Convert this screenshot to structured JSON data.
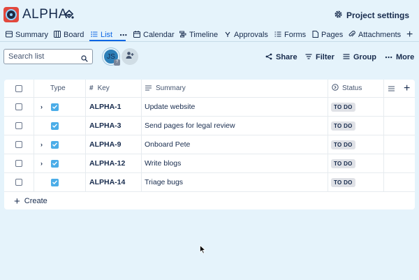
{
  "project": {
    "name": "ALPHA",
    "settings_label": "Project settings"
  },
  "tabs": [
    {
      "label": "Summary",
      "icon": "globe-icon"
    },
    {
      "label": "Board",
      "icon": "board-icon"
    },
    {
      "label": "List",
      "icon": "list-icon",
      "active": true
    },
    {
      "label": "Calendar",
      "icon": "calendar-icon"
    },
    {
      "label": "Timeline",
      "icon": "timeline-icon"
    },
    {
      "label": "Approvals",
      "icon": "approvals-icon"
    },
    {
      "label": "Forms",
      "icon": "forms-icon"
    },
    {
      "label": "Pages",
      "icon": "pages-icon"
    },
    {
      "label": "Attachments",
      "icon": "attachment-icon"
    }
  ],
  "toolbar": {
    "search_placeholder": "Search list",
    "avatar_initials": "JS",
    "share_label": "Share",
    "filter_label": "Filter",
    "group_label": "Group",
    "more_label": "More"
  },
  "table": {
    "headers": {
      "type": "Type",
      "key": "Key",
      "summary": "Summary",
      "status": "Status"
    },
    "rows": [
      {
        "key": "ALPHA-1",
        "summary": "Update website",
        "status": "TO DO",
        "expandable": true
      },
      {
        "key": "ALPHA-3",
        "summary": "Send pages for legal review",
        "status": "TO DO",
        "expandable": false
      },
      {
        "key": "ALPHA-9",
        "summary": "Onboard Pete",
        "status": "TO DO",
        "expandable": true
      },
      {
        "key": "ALPHA-12",
        "summary": "Write blogs",
        "status": "TO DO",
        "expandable": true
      },
      {
        "key": "ALPHA-14",
        "summary": "Triage bugs",
        "status": "TO DO",
        "expandable": false
      }
    ],
    "create_label": "Create"
  },
  "colors": {
    "background": "#e5f3fb",
    "accent": "#0c66e4",
    "task_type": "#4bade8",
    "project_icon": "#e2483d"
  }
}
